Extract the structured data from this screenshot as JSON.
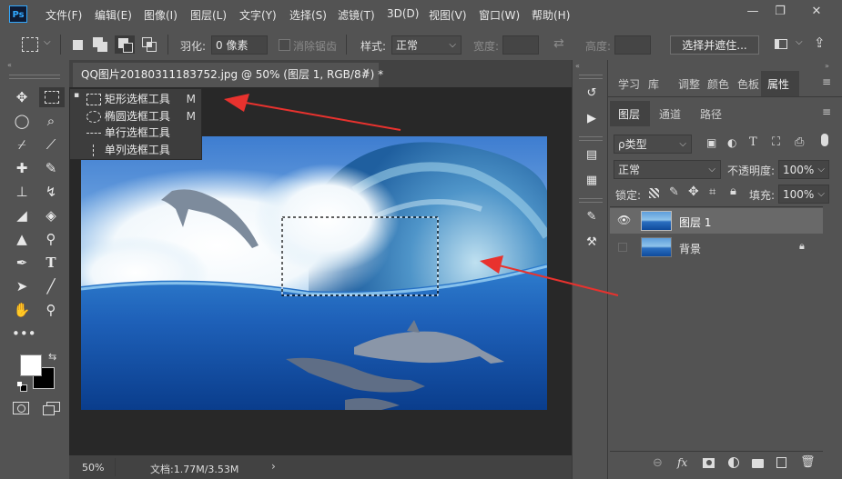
{
  "app": {
    "logo": "Ps"
  },
  "menu": [
    "文件(F)",
    "编辑(E)",
    "图像(I)",
    "图层(L)",
    "文字(Y)",
    "选择(S)",
    "滤镜(T)",
    "3D(D)",
    "视图(V)",
    "窗口(W)",
    "帮助(H)"
  ],
  "window_controls": {
    "minimize": "—",
    "restore": "❐",
    "close": "✕"
  },
  "options": {
    "feather_label": "羽化:",
    "feather_value": "0 像素",
    "antialias_label": "消除锯齿",
    "style_label": "样式:",
    "style_value": "正常",
    "width_label": "宽度:",
    "height_label": "高度:",
    "select_mask_button": "选择并遮住..."
  },
  "document": {
    "tab_title": "QQ图片20180311183752.jpg @ 50% (图层 1, RGB/8#) *",
    "close": "✕",
    "zoom": "50%",
    "doc_info": "文档:1.77M/3.53M",
    "status_arrow": "›"
  },
  "flyout": {
    "items": [
      {
        "label": "矩形选框工具",
        "shortcut": "M",
        "active": true,
        "icon": "rect-marquee-icon"
      },
      {
        "label": "椭圆选框工具",
        "shortcut": "M",
        "active": false,
        "icon": "ellipse-marquee-icon"
      },
      {
        "label": "单行选框工具",
        "shortcut": "",
        "active": false,
        "icon": "single-row-marquee-icon"
      },
      {
        "label": "单列选框工具",
        "shortcut": "",
        "active": false,
        "icon": "single-column-marquee-icon"
      }
    ],
    "bullet": "▪"
  },
  "panels": {
    "top_tabs": [
      "学习",
      "库",
      "调整",
      "颜色",
      "色板",
      "属性"
    ],
    "layer_tabs": [
      "图层",
      "通道",
      "路径"
    ],
    "kind_filter": "ρ类型",
    "blend_mode": "正常",
    "opacity_label": "不透明度:",
    "opacity_value": "100%",
    "lock_label": "锁定:",
    "fill_label": "填充:",
    "fill_value": "100%",
    "layers": [
      {
        "name": "图层 1",
        "visible": true,
        "selected": true,
        "locked": false
      },
      {
        "name": "背景",
        "visible": false,
        "selected": false,
        "locked": true
      }
    ],
    "bottom_icons": {
      "link": "⊖",
      "fx": "fx"
    }
  },
  "colors": {
    "accent": "#31a8ff",
    "arrow": "#e8322e",
    "panel_bg": "#535353",
    "canvas_bg": "#282828"
  }
}
